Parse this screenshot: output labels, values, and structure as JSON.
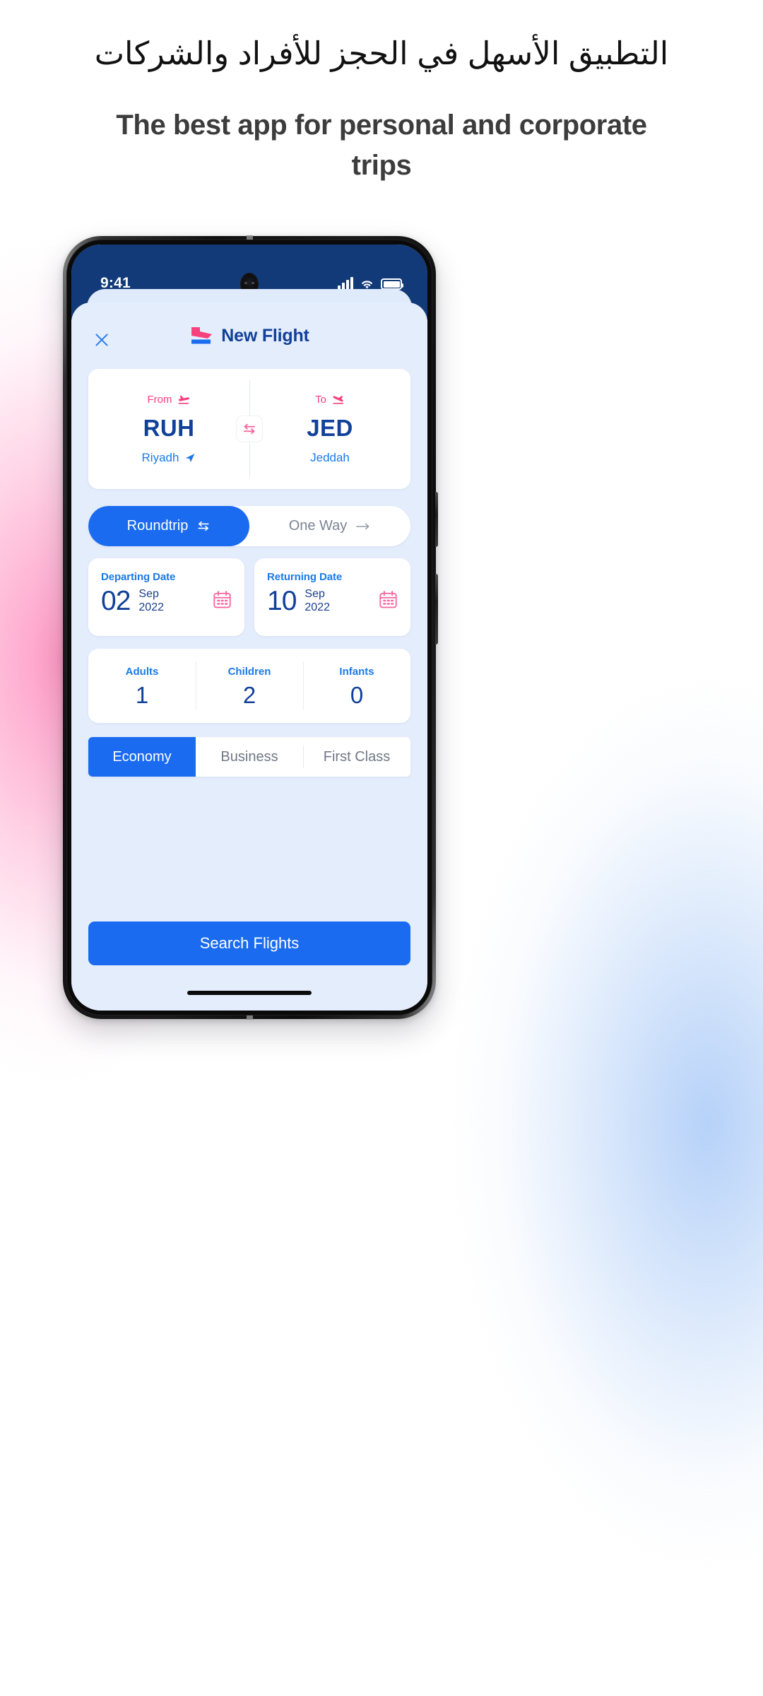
{
  "page": {
    "headline_arabic": "التطبيق الأسهل في الحجز للأفراد والشركات",
    "headline_english": "The best app for personal and corporate trips"
  },
  "colors": {
    "brand_blue": "#11409a",
    "accent_blue": "#1a6bf0",
    "link_blue": "#1b7ae8",
    "accent_pink": "#f8407c",
    "statusbar_navy": "#123a78",
    "sheet_bg": "#e4edfc"
  },
  "phone": {
    "statusbar": {
      "time": "9:41",
      "signal_icon": "cellular-signal-icon",
      "wifi_icon": "wifi-icon",
      "battery_icon": "battery-full-icon",
      "camera_icon": "front-camera-icon"
    },
    "home_indicator": "home-indicator"
  },
  "header": {
    "close_icon": "close-icon",
    "logo_icon": "brand-logo-icon",
    "title": "New Flight"
  },
  "route": {
    "from": {
      "label": "From",
      "icon": "airplane-takeoff-icon",
      "code": "RUH",
      "city": "Riyadh",
      "city_icon": "location-arrow-icon"
    },
    "to": {
      "label": "To",
      "icon": "airplane-landing-icon",
      "code": "JED",
      "city": "Jeddah",
      "city_icon": ""
    },
    "swap_icon": "swap-horizontal-icon"
  },
  "trip_type": {
    "options": [
      {
        "label": "Roundtrip",
        "icon": "swap-arrows-icon",
        "selected": true
      },
      {
        "label": "One Way",
        "icon": "arrow-right-icon",
        "selected": false
      }
    ]
  },
  "dates": [
    {
      "title": "Departing Date",
      "day": "02",
      "month": "Sep",
      "year": "2022",
      "icon": "calendar-icon"
    },
    {
      "title": "Returning Date",
      "day": "10",
      "month": "Sep",
      "year": "2022",
      "icon": "calendar-icon"
    }
  ],
  "passengers": [
    {
      "label": "Adults",
      "value": "1"
    },
    {
      "label": "Children",
      "value": "2"
    },
    {
      "label": "Infants",
      "value": "0"
    }
  ],
  "cabin_class": {
    "options": [
      {
        "label": "Economy",
        "selected": true
      },
      {
        "label": "Business",
        "selected": false
      },
      {
        "label": "First Class",
        "selected": false
      }
    ]
  },
  "actions": {
    "search_label": "Search Flights"
  }
}
